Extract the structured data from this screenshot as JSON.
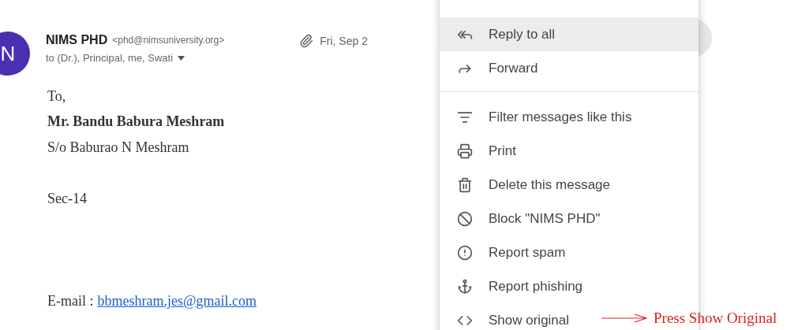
{
  "message": {
    "avatar": "N",
    "sender": "NIMS PHD",
    "address": "<phd@nimsuniversity.org>",
    "recipients": "to (Dr.), Principal, me, Swati",
    "date": "Fri, Sep 2",
    "body": [
      {
        "kind": "text",
        "text": "To,"
      },
      {
        "kind": "bold",
        "text": "Mr. Bandu Babura Meshram"
      },
      {
        "kind": "text",
        "text": "S/o Baburao N Meshram"
      },
      {
        "kind": "redacted"
      },
      {
        "kind": "text",
        "text": "Sec-14"
      },
      {
        "kind": "redacted"
      },
      {
        "kind": "redacted"
      },
      {
        "kind": "redacted"
      },
      {
        "kind": "email",
        "label": "E-mail :",
        "link": "bbmeshram.jes@gmail.com"
      }
    ]
  },
  "menu": {
    "items": [
      {
        "kind": "reply-all",
        "label": "Reply to all",
        "selected": true
      },
      {
        "kind": "forward",
        "label": "Forward",
        "selected": false
      },
      {
        "kind": "divider"
      },
      {
        "kind": "filter",
        "label": "Filter messages like this",
        "selected": false
      },
      {
        "kind": "print",
        "label": "Print",
        "selected": false
      },
      {
        "kind": "delete",
        "label": "Delete this message",
        "selected": false
      },
      {
        "kind": "block",
        "label": "Block \"NIMS PHD\"",
        "selected": false
      },
      {
        "kind": "spam",
        "label": "Report spam",
        "selected": false
      },
      {
        "kind": "phishing",
        "label": "Report phishing",
        "selected": false
      },
      {
        "kind": "original",
        "label": "Show original",
        "selected": false
      }
    ]
  },
  "annotation": {
    "text": "Press Show Original"
  }
}
